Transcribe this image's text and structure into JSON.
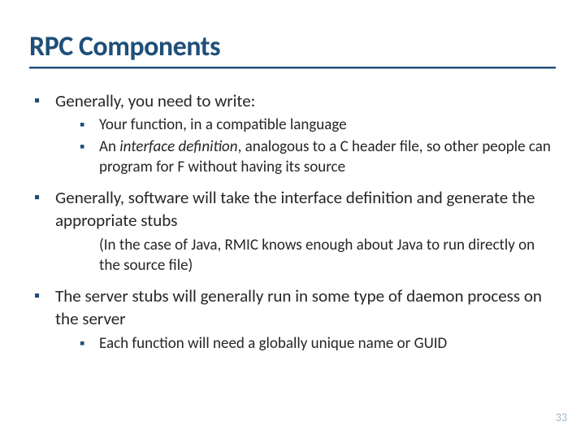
{
  "title": "RPC Components",
  "bullets": [
    {
      "text": "Generally, you need to write:",
      "sub": [
        {
          "text": "Your function, in a compatible language"
        },
        {
          "prefix": "An ",
          "em": "interface definition",
          "suffix": ", analogous to a C header file, so other people can program for F without having its source"
        }
      ]
    },
    {
      "text": "Generally, software will take the interface definition and generate the appropriate stubs",
      "para": "(In the case of Java, RMIC knows enough about Java to run directly on the source file)"
    },
    {
      "text": "The server stubs will generally run in some type of daemon process on the server",
      "sub": [
        {
          "text": "Each function will need a globally unique name or GUID"
        }
      ]
    }
  ],
  "page_number": "33"
}
